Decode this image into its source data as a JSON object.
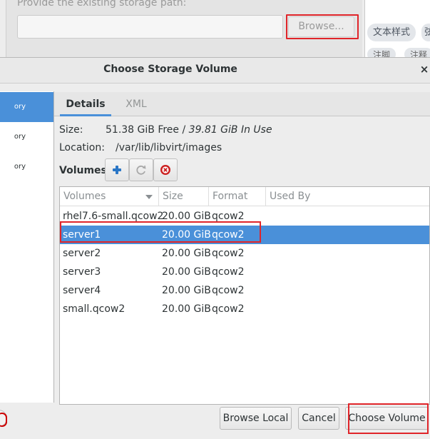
{
  "background": {
    "path_label": "Provide the existing storage path:",
    "path_value": "",
    "browse_label": "Browse...",
    "style_chips": [
      "文本样式",
      "弦",
      "注脚",
      "注释"
    ]
  },
  "dialog": {
    "title": "Choose Storage Volume",
    "close_glyph": "×"
  },
  "pools": {
    "items": [
      {
        "label": "ory",
        "selected": true
      },
      {
        "label": "ory",
        "selected": false
      },
      {
        "label": "ory",
        "selected": false
      }
    ]
  },
  "tabs": [
    {
      "label": "Details",
      "active": true
    },
    {
      "label": "XML",
      "active": false
    }
  ],
  "details": {
    "size_label": "Size:",
    "size_free": "51.38 GiB Free / ",
    "size_inuse": "39.81 GiB In Use",
    "location_label": "Location:",
    "location_value": "/var/lib/libvirt/images"
  },
  "volumes_toolbar": {
    "label": "Volumes",
    "buttons": [
      "add-icon",
      "refresh-icon",
      "delete-icon"
    ]
  },
  "volume_table": {
    "columns": [
      "Volumes",
      "Size",
      "Format",
      "Used By"
    ],
    "rows": [
      {
        "name": "rhel7.6-small.qcow2",
        "size": "20.00 GiB",
        "format": "qcow2",
        "used_by": "",
        "selected": false
      },
      {
        "name": "server1",
        "size": "20.00 GiB",
        "format": "qcow2",
        "used_by": "",
        "selected": true
      },
      {
        "name": "server2",
        "size": "20.00 GiB",
        "format": "qcow2",
        "used_by": "",
        "selected": false
      },
      {
        "name": "server3",
        "size": "20.00 GiB",
        "format": "qcow2",
        "used_by": "",
        "selected": false
      },
      {
        "name": "server4",
        "size": "20.00 GiB",
        "format": "qcow2",
        "used_by": "",
        "selected": false
      },
      {
        "name": "small.qcow2",
        "size": "20.00 GiB",
        "format": "qcow2",
        "used_by": "",
        "selected": false
      }
    ]
  },
  "buttons": {
    "browse_local": "Browse Local",
    "cancel": "Cancel",
    "choose_volume": "Choose Volume"
  },
  "colors": {
    "selection": "#4a90d9",
    "highlight_box": "#e0252a"
  }
}
